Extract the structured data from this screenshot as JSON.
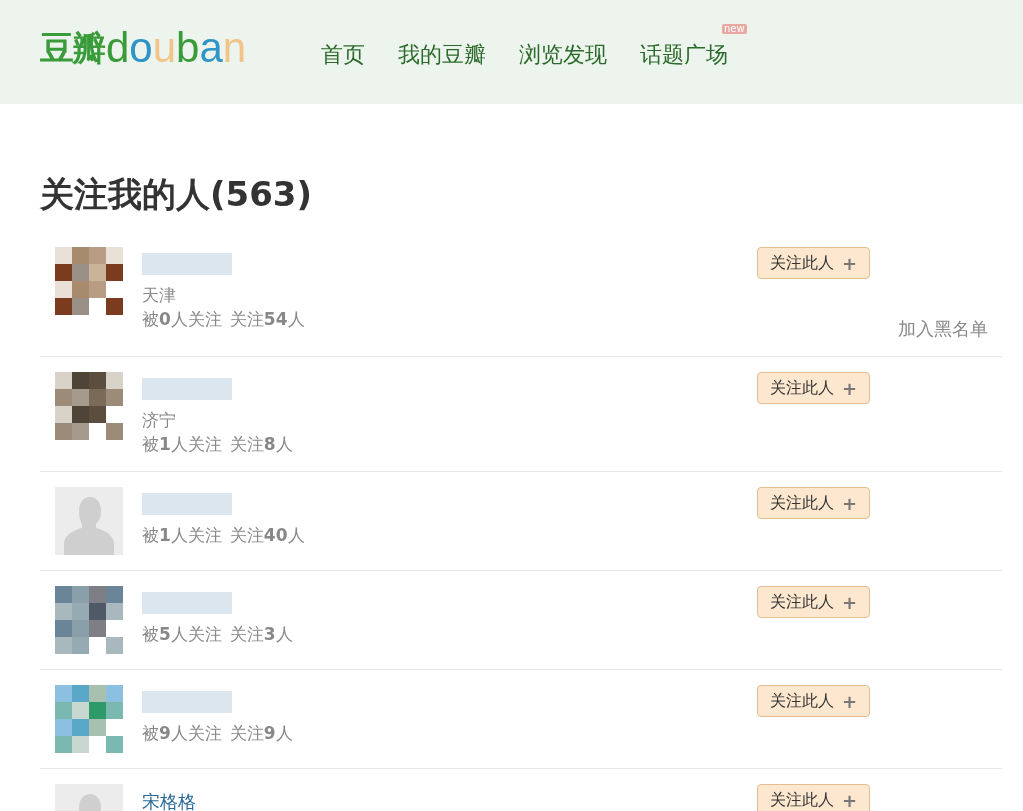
{
  "header": {
    "logo_cn": "豆瓣",
    "logo_en": [
      "d",
      "o",
      "u",
      "b",
      "a",
      "n"
    ],
    "nav": [
      {
        "label": "首页"
      },
      {
        "label": "我的豆瓣"
      },
      {
        "label": "浏览发现"
      },
      {
        "label": "话题广场",
        "badge": "new"
      }
    ]
  },
  "page_title": "关注我的人(563)",
  "people": [
    {
      "name_blurred": true,
      "location": "天津",
      "followers": "被**0**人关注",
      "following": "关注**54**人",
      "button": "关注此人",
      "button_icon": "+",
      "blacklist": "加入黑名单"
    },
    {
      "name_blurred": true,
      "location": "济宁",
      "followers": "被**1**人关注",
      "following": "关注**8**人",
      "button": "关注此人",
      "button_icon": "+"
    },
    {
      "avatar": {
        "kind": "default"
      },
      "name_blurred": true,
      "followers": "被**1**人关注",
      "following": "关注**40**人",
      "button": "关注此人",
      "button_icon": "+"
    },
    {
      "name_blurred": true,
      "followers": "被**5**人关注",
      "following": "关注**3**人",
      "button": "关注此人",
      "button_icon": "+"
    },
    {
      "name_blurred": true,
      "followers": "被**9**人关注",
      "following": "关注**9**人",
      "button": "关注此人",
      "button_icon": "+"
    },
    {
      "avatar": {
        "kind": "default"
      },
      "name": "宋格格",
      "button": "关注此人",
      "button_icon": "+"
    }
  ]
}
